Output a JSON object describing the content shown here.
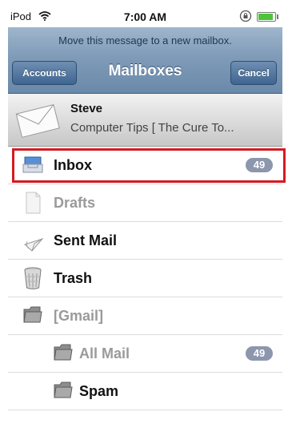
{
  "status_bar": {
    "carrier": "iPod",
    "time": "7:00 AM"
  },
  "prompt": "Move this message to a new mailbox.",
  "nav": {
    "back_label": "Accounts",
    "title": "Mailboxes",
    "cancel_label": "Cancel"
  },
  "message": {
    "sender": "Steve",
    "subject": "Computer Tips [ The Cure To..."
  },
  "mailboxes": [
    {
      "label": "Inbox",
      "badge": "49",
      "icon": "inbox-icon",
      "enabled": true
    },
    {
      "label": "Drafts",
      "icon": "drafts-icon",
      "enabled": false
    },
    {
      "label": "Sent Mail",
      "icon": "sent-mail-icon",
      "enabled": true
    },
    {
      "label": "Trash",
      "icon": "trash-icon",
      "enabled": true
    },
    {
      "label": "[Gmail]",
      "icon": "folder-icon",
      "enabled": false
    },
    {
      "label": "All Mail",
      "badge": "49",
      "icon": "folder-icon",
      "enabled": true
    },
    {
      "label": "Spam",
      "icon": "folder-icon",
      "enabled": true
    }
  ],
  "colors": {
    "highlight": "#d31b22",
    "nav_bar": "#7f9bb8",
    "badge": "#8c97ad"
  }
}
